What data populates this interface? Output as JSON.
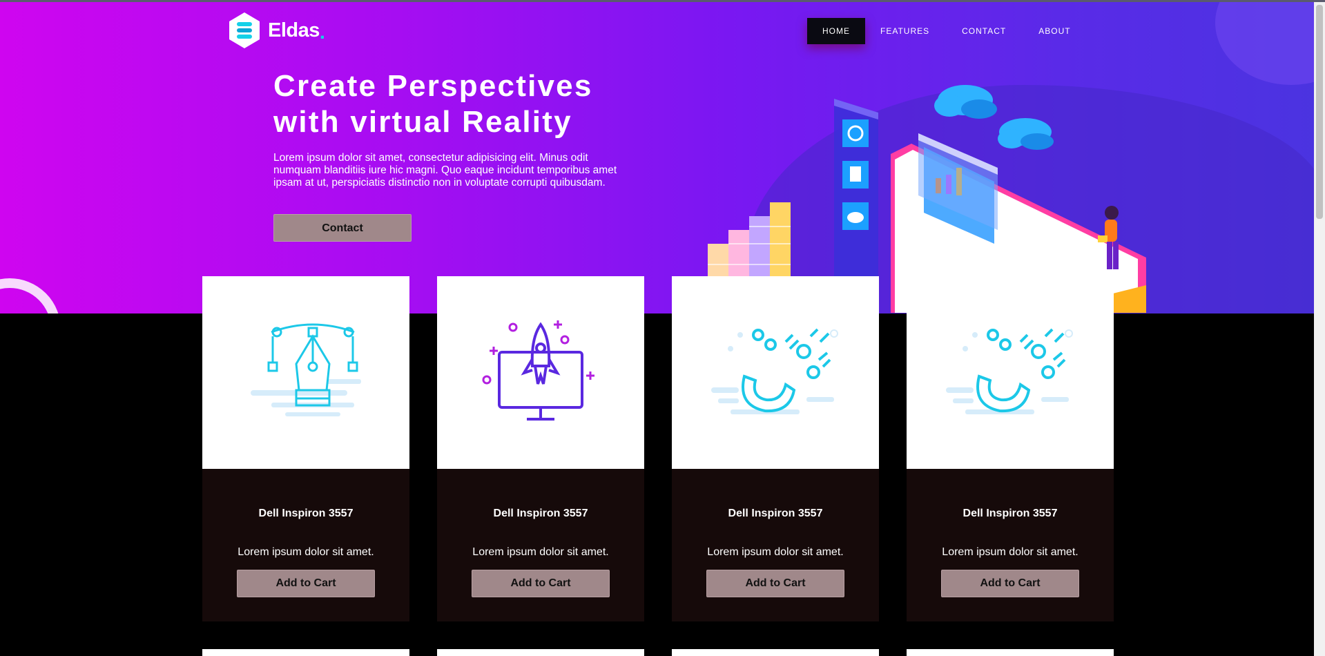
{
  "brand": {
    "name": "Eldas",
    "accent_dot": ".",
    "accent_color": "#14d1e8"
  },
  "nav": {
    "items": [
      {
        "label": "HOME",
        "active": true
      },
      {
        "label": "FEATURES",
        "active": false
      },
      {
        "label": "CONTACT",
        "active": false
      },
      {
        "label": "ABOUT",
        "active": false
      }
    ]
  },
  "hero": {
    "title_line1": "Create Perspectives",
    "title_line2": "with virtual Reality",
    "text": "Lorem ipsum dolor sit amet, consectetur adipisicing elit. Minus odit numquam blanditiis iure hic magni. Quo eaque incidunt temporibus amet ipsam at ut, perspiciatis distinctio non in voluptate corrupti quibusdam.",
    "button_label": "Contact",
    "gradient": [
      "#cf05f0",
      "#7a17f2",
      "#4a34e0"
    ]
  },
  "cards": [
    {
      "icon": "pen-tool-icon",
      "title": "Dell Inspiron 3557",
      "description": "Lorem ipsum dolor sit amet.",
      "button_label": "Add to Cart"
    },
    {
      "icon": "rocket-monitor-icon",
      "title": "Dell Inspiron 3557",
      "description": "Lorem ipsum dolor sit amet.",
      "button_label": "Add to Cart"
    },
    {
      "icon": "magnet-icon",
      "title": "Dell Inspiron 3557",
      "description": "Lorem ipsum dolor sit amet.",
      "button_label": "Add to Cart"
    },
    {
      "icon": "magnet-icon",
      "title": "Dell Inspiron 3557",
      "description": "Lorem ipsum dolor sit amet.",
      "button_label": "Add to Cart"
    }
  ],
  "colors": {
    "button_bg": "#a0888a",
    "card_body_bg": "#160a0a",
    "page_bg": "#000000"
  }
}
